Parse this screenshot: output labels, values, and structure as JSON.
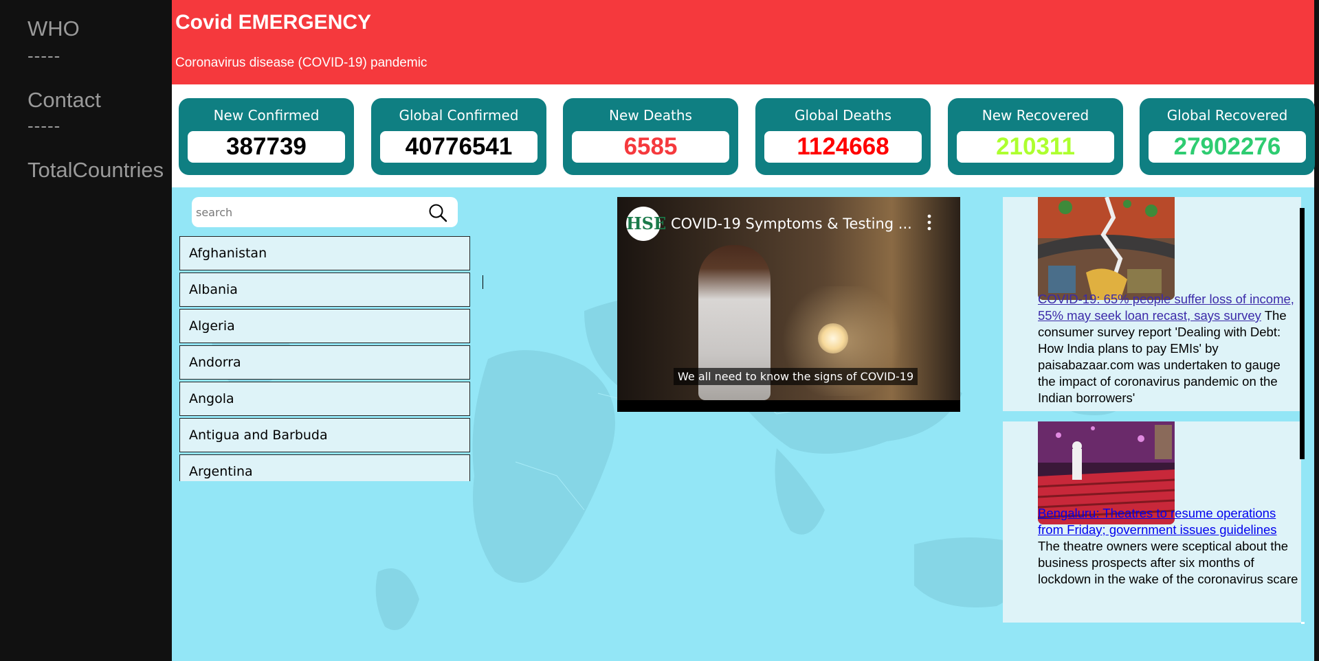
{
  "sidebar": {
    "links": [
      "WHO",
      "Contact",
      "TotalCountries"
    ],
    "separator": "-----"
  },
  "header": {
    "title": "Covid EMERGENCY",
    "subtitle": "Coronavirus disease (COVID-19) pandemic"
  },
  "stats": [
    {
      "label": "New Confirmed",
      "value": "387739",
      "color": "#000000"
    },
    {
      "label": "Global Confirmed",
      "value": "40776541",
      "color": "#000000"
    },
    {
      "label": "New Deaths",
      "value": "6585",
      "color": "#f5393d"
    },
    {
      "label": "Global Deaths",
      "value": "1124668",
      "color": "#ff0000"
    },
    {
      "label": "New Recovered",
      "value": "210311",
      "color": "#adff2f"
    },
    {
      "label": "Global Recovered",
      "value": "27902276",
      "color": "#2ecc71"
    }
  ],
  "search": {
    "placeholder": "search",
    "icon": "search-icon"
  },
  "countries": [
    "Afghanistan",
    "Albania",
    "Algeria",
    "Andorra",
    "Angola",
    "Antigua and Barbuda",
    "Argentina"
  ],
  "video": {
    "channel_logo": "HSE",
    "title": "COVID-19 Symptoms & Testing ...",
    "caption": "We all need to know the signs of COVID-19",
    "more_icon": "more-vertical-icon"
  },
  "news": [
    {
      "headline": "COVID-19: 65% people suffer loss of income, 55% may seek loan recast, says survey",
      "body": "The consumer survey report 'Dealing with Debt: How India plans to pay EMIs' by paisabazaar.com was undertaken to gauge the impact of coronavirus pandemic on the Indian borrowers'"
    },
    {
      "headline": "Bengaluru: Theatres to resume operations from Friday; government issues guidelines",
      "body": "The theatre owners were sceptical about the business prospects after six months of lockdown in the wake of the coronavirus scare"
    }
  ],
  "colors": {
    "sidebar_bg": "#111111",
    "header_bg": "#f5393d",
    "stat_card": "#0f7f82",
    "main_bg": "#93e6f6"
  }
}
